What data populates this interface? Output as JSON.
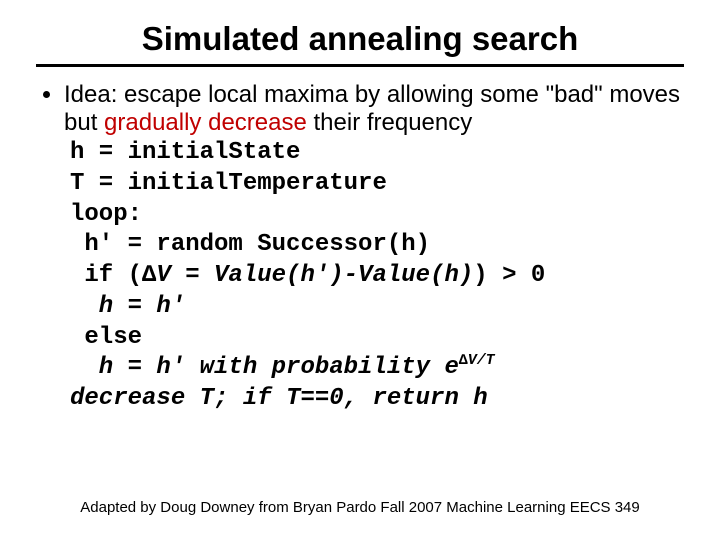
{
  "title": "Simulated annealing search",
  "bullet": {
    "pre": "Idea: escape local maxima by allowing some \"bad\" moves but ",
    "highlight": "gradually decrease",
    "post": " their frequency"
  },
  "code": {
    "l1": "h = initialState",
    "l2": "T = initialTemperature",
    "l3": "loop:",
    "l4": " h' = random Successor(h)",
    "l5_pre": " if (",
    "l5_it": "∆V = Value(h')-Value(h)",
    "l5_post": ") > 0",
    "l6": "  h = h'",
    "l7": " else",
    "l8_it_pre": "  h = h' with probability e",
    "l8_sup": "∆V/T",
    "l9_it": "decrease T; if T==0, return h"
  },
  "footer": "Adapted by Doug Downey from Bryan Pardo  Fall 2007 Machine Learning EECS 349"
}
